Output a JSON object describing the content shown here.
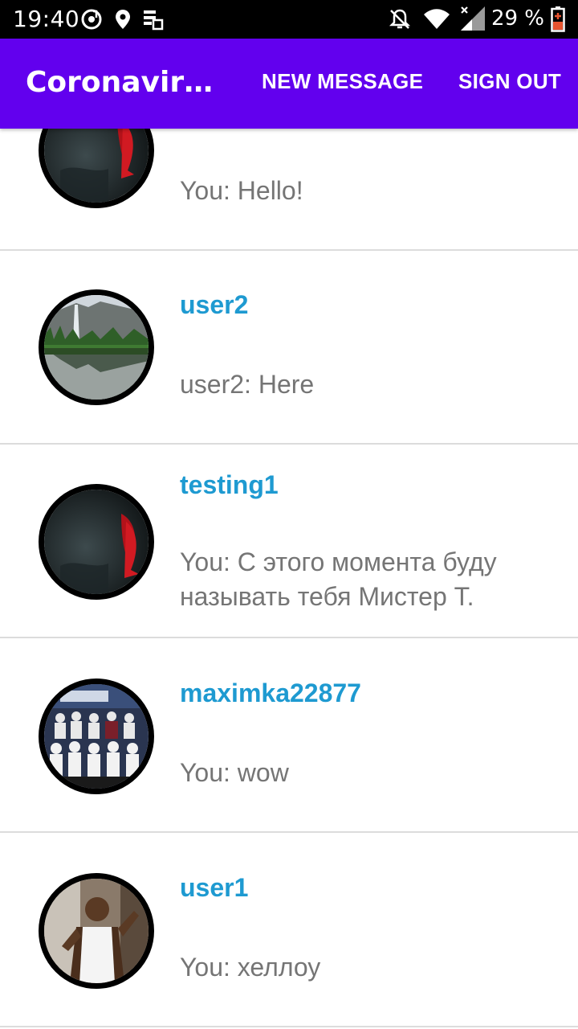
{
  "status_bar": {
    "time": "19:40",
    "battery": "29 %",
    "icons": [
      "music-app-icon",
      "location-icon",
      "notification-stack-icon",
      "notifications-off-icon",
      "wifi-icon",
      "signal-icon",
      "battery-low-icon"
    ]
  },
  "app_bar": {
    "title": "Coronaviru…",
    "new_message_label": "NEW MESSAGE",
    "sign_out_label": "SIGN OUT",
    "color": "#6200ee"
  },
  "conversations": [
    {
      "username": "",
      "message": "You: Hello!",
      "avatar": "dark-red-figure"
    },
    {
      "username": "user2",
      "message": "user2: Here",
      "avatar": "waterfall-landscape"
    },
    {
      "username": "testing1",
      "message": "You: С этого момента буду называть тебя Мистер Т.",
      "avatar": "dark-red-figure"
    },
    {
      "username": "maximka22877",
      "message": "You: wow",
      "avatar": "group-photo"
    },
    {
      "username": "user1",
      "message": "You: хеллоу",
      "avatar": "man-white-tank-top"
    }
  ],
  "colors": {
    "username": "#1e9ad1",
    "message": "#757575",
    "divider": "#dcdcdc"
  }
}
